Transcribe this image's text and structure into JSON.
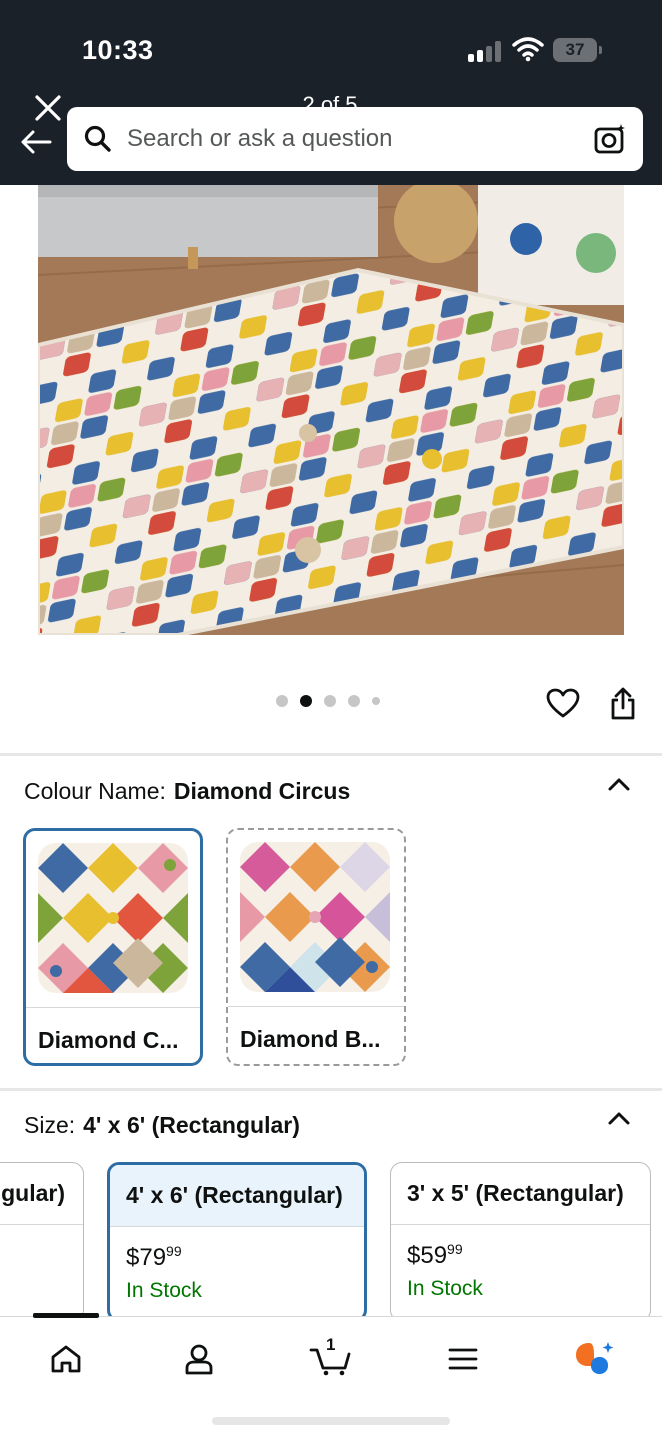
{
  "status_bar": {
    "time": "10:33",
    "battery": "37"
  },
  "header": {
    "page_counter": "2 of 5",
    "search_placeholder": "Search or ask a question"
  },
  "gallery": {
    "image_count": 5,
    "active_index": 1
  },
  "colour": {
    "label": "Colour Name:",
    "selected_value": "Diamond Circus",
    "options": [
      {
        "label": "Diamond C...",
        "selected": true
      },
      {
        "label": "Diamond B...",
        "selected": false
      }
    ]
  },
  "size": {
    "label": "Size:",
    "selected_value": "4' x 6' (Rectangular)",
    "options": [
      {
        "label": "gular)",
        "price_dollars": "",
        "price_cents": "",
        "stock": ""
      },
      {
        "label": "4' x 6' (Rectangular)",
        "price_dollars": "$79",
        "price_cents": "99",
        "stock": "In Stock",
        "selected": true
      },
      {
        "label": "3' x 5' (Rectangular)",
        "price_dollars": "$59",
        "price_cents": "99",
        "stock": "In Stock"
      }
    ]
  },
  "bottom_nav": {
    "items": [
      "home-icon",
      "account-icon",
      "cart-icon",
      "menu-icon",
      "rufus-assistant-icon"
    ],
    "cart_count": "1"
  },
  "colors": {
    "header_bg": "#1b2129",
    "selected_border": "#2e6da4",
    "in_stock": "#007600"
  }
}
